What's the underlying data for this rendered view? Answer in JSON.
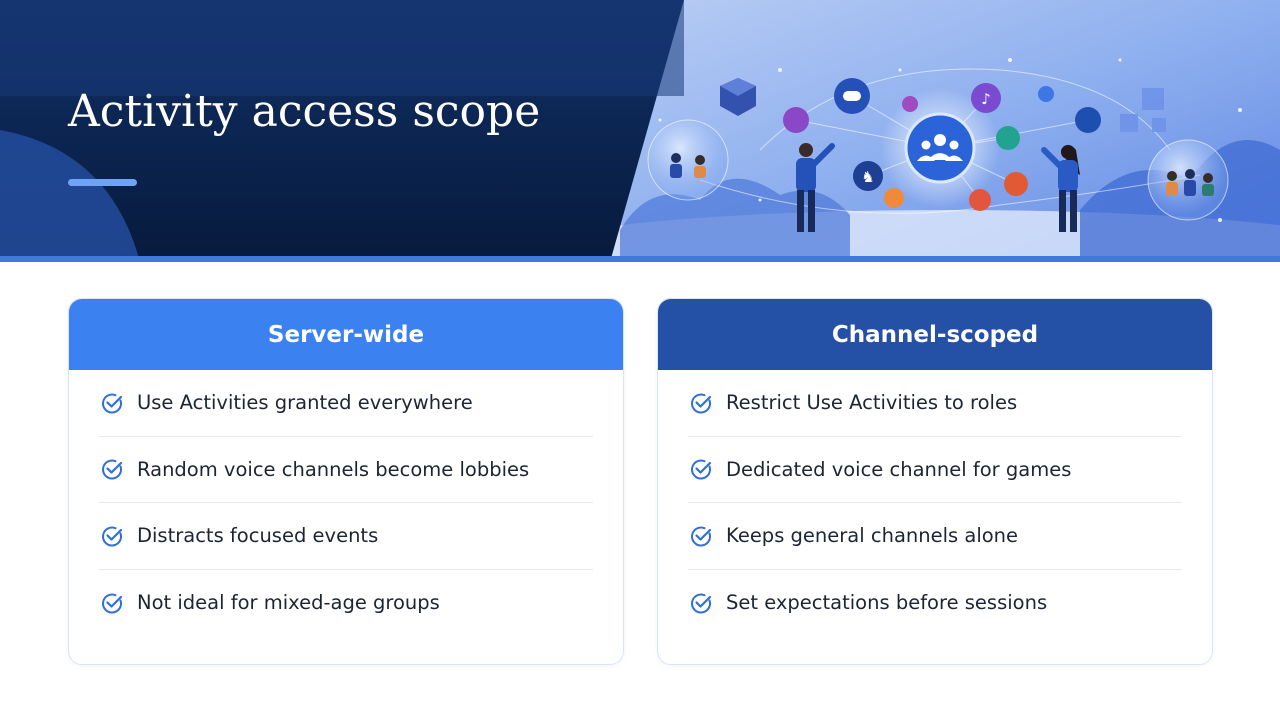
{
  "slide": {
    "title": "Activity access scope"
  },
  "colors": {
    "hero_dark": "#0f2a5c",
    "accent_blue": "#3b82f0",
    "accent_navy": "#2451a6",
    "check": "#2f6fd8",
    "text": "#1d2433"
  },
  "illustration": {
    "description_icons": [
      "group-icon",
      "gamepad-icon",
      "music-icon",
      "chess-icon",
      "crystal-icon"
    ]
  },
  "cards": {
    "left": {
      "title": "Server-wide",
      "items": [
        "Use Activities granted everywhere",
        "Random voice channels become lobbies",
        "Distracts focused events",
        "Not ideal for mixed-age groups"
      ]
    },
    "right": {
      "title": "Channel-scoped",
      "items": [
        "Restrict Use Activities to roles",
        "Dedicated voice channel for games",
        "Keeps general channels alone",
        "Set expectations before sessions"
      ]
    }
  }
}
